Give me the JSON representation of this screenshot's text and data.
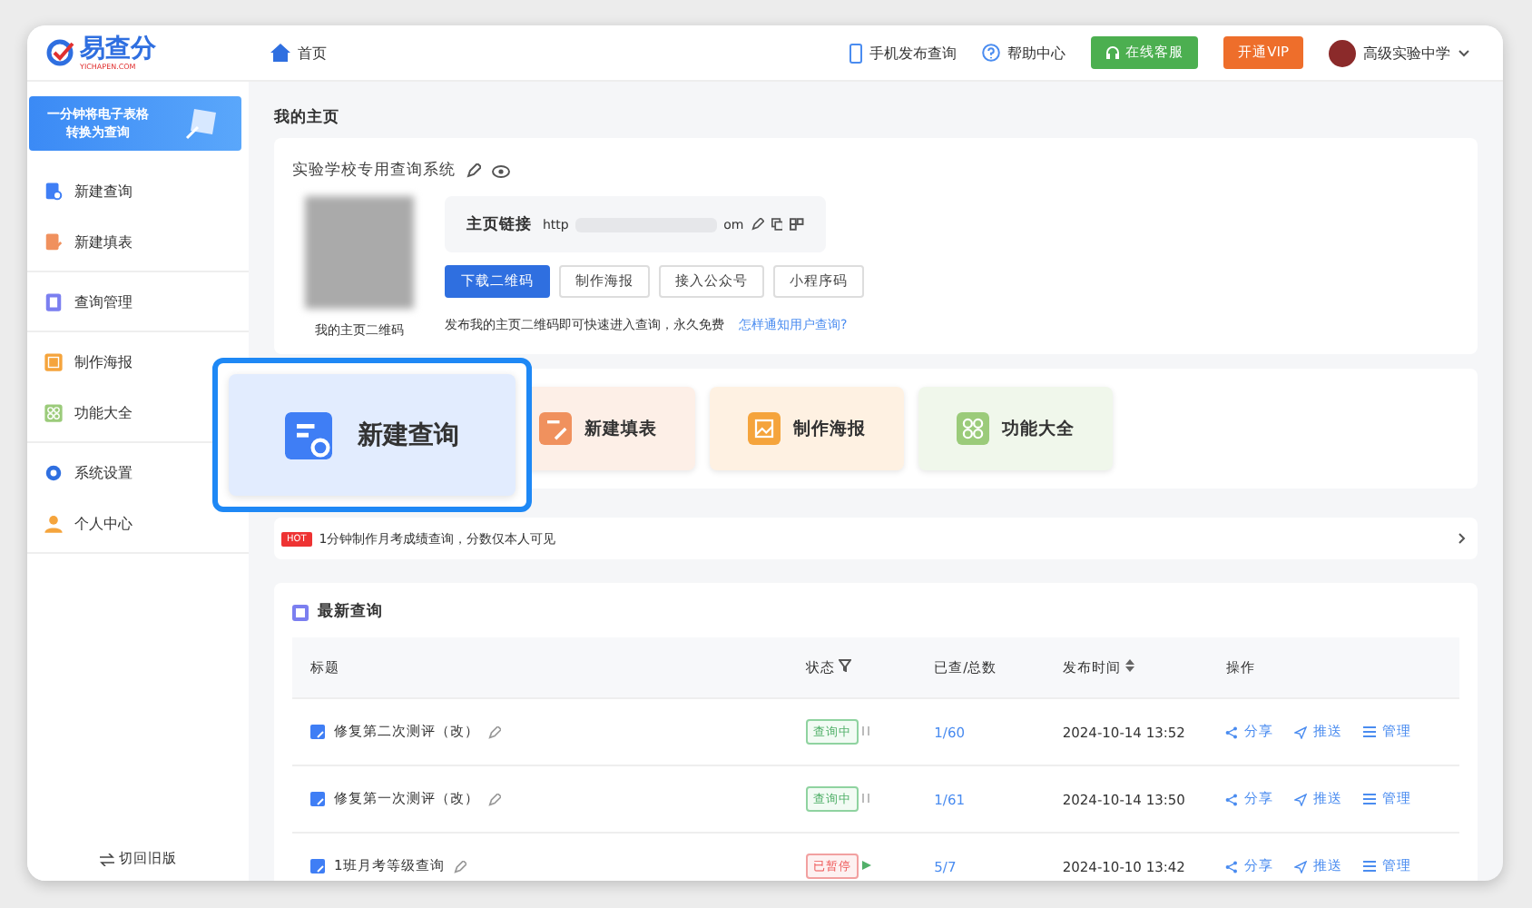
{
  "header": {
    "logo_text": "易查分",
    "logo_sub": "YICHAPEN.COM",
    "breadcrumb": "首页",
    "links": [
      {
        "label": "手机发布查询",
        "kind": "phone"
      },
      {
        "label": "帮助中心",
        "kind": "help"
      }
    ],
    "service_button": "在线客服",
    "vip_button": "开通VIP",
    "user": "高级实验中学"
  },
  "sidebar": {
    "banner": [
      "一分钟将电子表格",
      "转换为查询"
    ],
    "groups": [
      [
        {
          "label": "新建查询",
          "kind": "query"
        },
        {
          "label": "新建填表",
          "kind": "form"
        }
      ],
      [
        {
          "label": "查询管理",
          "kind": "manage"
        }
      ],
      [
        {
          "label": "制作海报",
          "kind": "poster"
        },
        {
          "label": "功能大全",
          "kind": "grid"
        }
      ],
      [
        {
          "label": "系统设置",
          "kind": "settings"
        },
        {
          "label": "个人中心",
          "kind": "person"
        }
      ]
    ],
    "switch_label": "切回旧版"
  },
  "homepage": {
    "heading": "我的主页",
    "system_name": "实验学校专用查询系统",
    "qr_caption": "我的主页二维码",
    "link_label": "主页链接",
    "url_start": "http",
    "url_end": "om",
    "buttons": [
      {
        "label": "下载二维码",
        "primary": true
      },
      {
        "label": "制作海报",
        "primary": false
      },
      {
        "label": "接入公众号",
        "primary": false
      },
      {
        "label": "小程序码",
        "primary": false
      }
    ],
    "description": "发布我的主页二维码即可快速进入查询，永久免费",
    "help_link": "怎样通知用户查询?"
  },
  "quick_actions": [
    {
      "label": "新建查询",
      "kind": "query",
      "color": "#3f7ef5",
      "highlighted": true
    },
    {
      "label": "新建填表",
      "kind": "form",
      "color": "#f0915e",
      "highlighted": false
    },
    {
      "label": "制作海报",
      "kind": "poster",
      "color": "#f5a43c",
      "highlighted": false
    },
    {
      "label": "功能大全",
      "kind": "grid",
      "color": "#9bcb7a",
      "highlighted": false
    }
  ],
  "notice": {
    "badge": "HOT",
    "text": "1分钟制作月考成绩查询，分数仅本人可见"
  },
  "latest": {
    "heading": "最新查询",
    "columns": [
      "标题",
      "状态",
      "已查/总数",
      "发布时间",
      "操作"
    ],
    "rows": [
      {
        "title": "修复第二次测评（改）",
        "status": "查询中",
        "kind": "running",
        "count": "1/60",
        "time": "2024-10-14 13:52",
        "actions": [
          "分享",
          "推送",
          "管理"
        ]
      },
      {
        "title": "修复第一次测评（改）",
        "status": "查询中",
        "kind": "running",
        "count": "1/61",
        "time": "2024-10-14 13:50",
        "actions": [
          "分享",
          "推送",
          "管理"
        ]
      },
      {
        "title": "1班月考等级查询",
        "status": "已暂停",
        "kind": "paused",
        "count": "5/7",
        "time": "2024-10-10 13:42",
        "actions": [
          "分享",
          "推送",
          "管理"
        ]
      }
    ]
  }
}
